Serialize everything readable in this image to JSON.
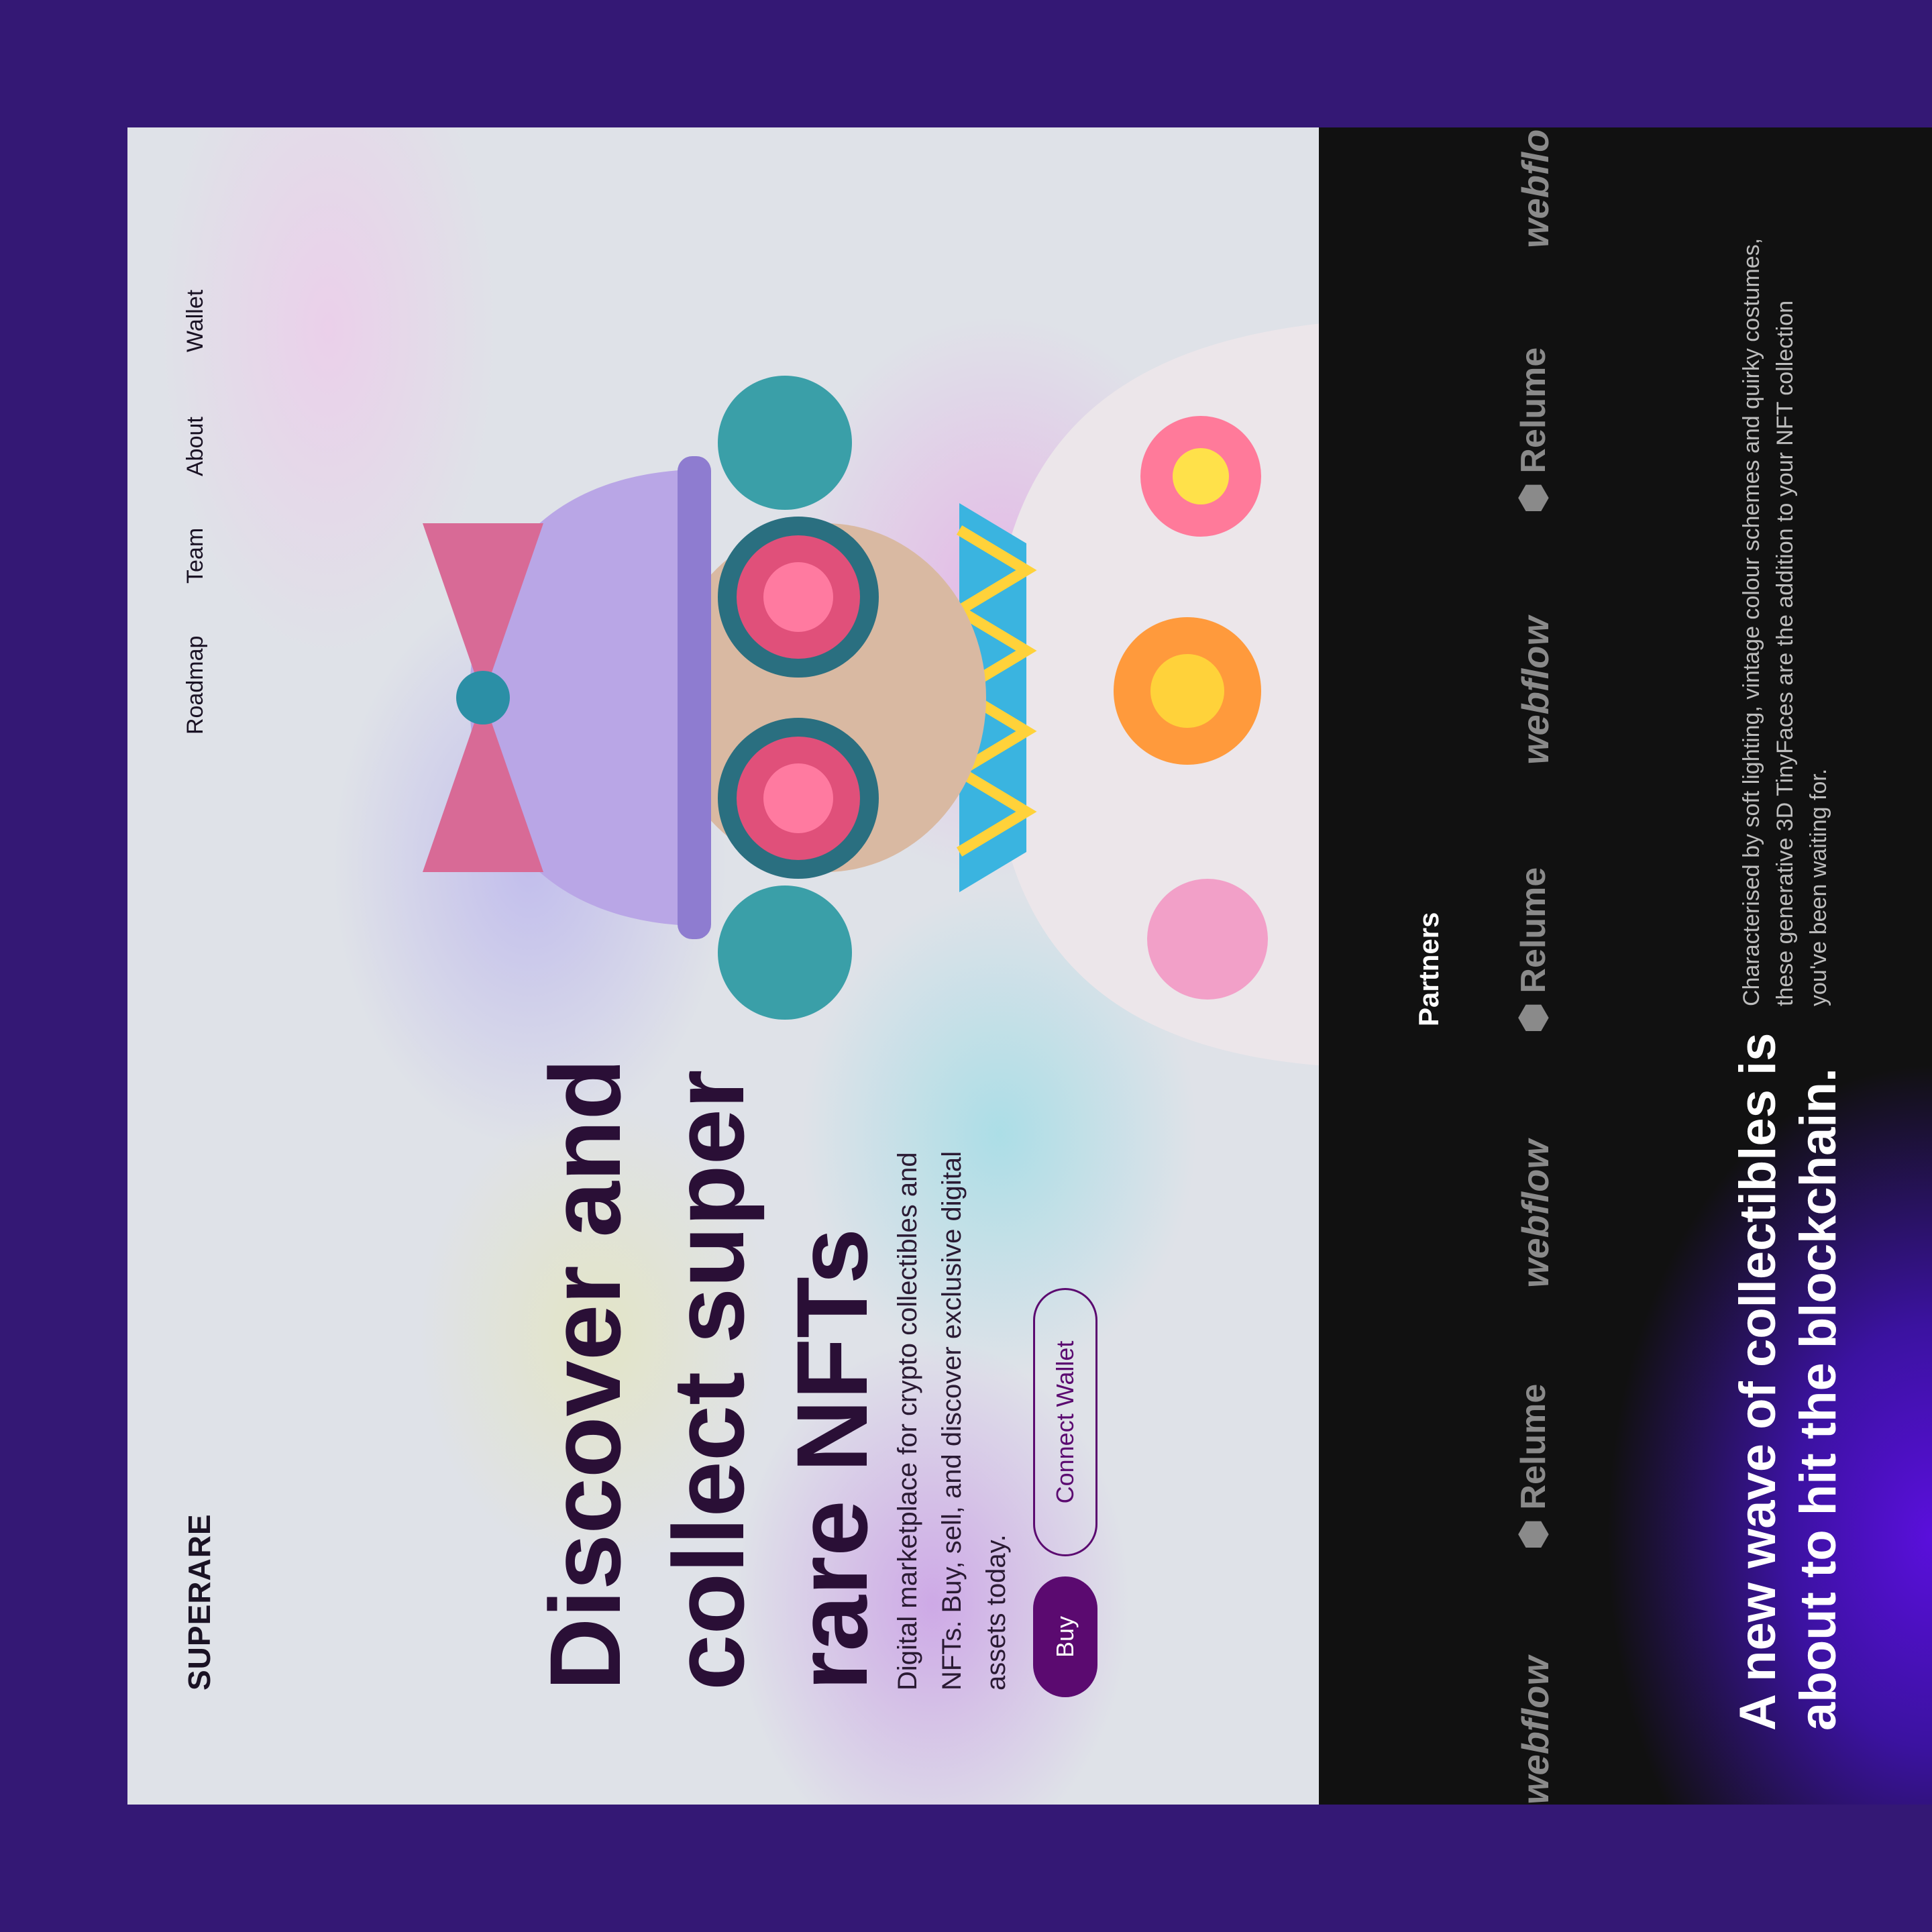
{
  "nav": {
    "logo": "SUPERARE",
    "links": [
      "Roadmap",
      "Team",
      "About",
      "Wallet"
    ]
  },
  "hero": {
    "headline": "Discover and collect super rare NFTs",
    "subtext": "Digital marketplace for crypto collectibles and NFTs. Buy, sell, and discover exclusive digital assets today.",
    "buy_label": "Buy",
    "connect_label": "Connect Wallet",
    "image": "nft-character-illustration"
  },
  "partners": {
    "label": "Partners",
    "logos": [
      "webflow",
      "Relume",
      "webflow",
      "Relume",
      "webflow",
      "Relume",
      "webflow"
    ]
  },
  "about": {
    "heading": "A new wave of collectibles is about to hit the blockchain.",
    "description": "Characterised by soft lighting, vintage colour schemes and quirky costumes, these generative 3D TinyFaces are the addition to your NFT collection you've been waiting for."
  },
  "colors": {
    "background": "#341875",
    "accent": "#5b0a70",
    "hero_bg": "#dfe2e8",
    "dark_bg": "#111111",
    "glow": "#5a0fdc"
  }
}
